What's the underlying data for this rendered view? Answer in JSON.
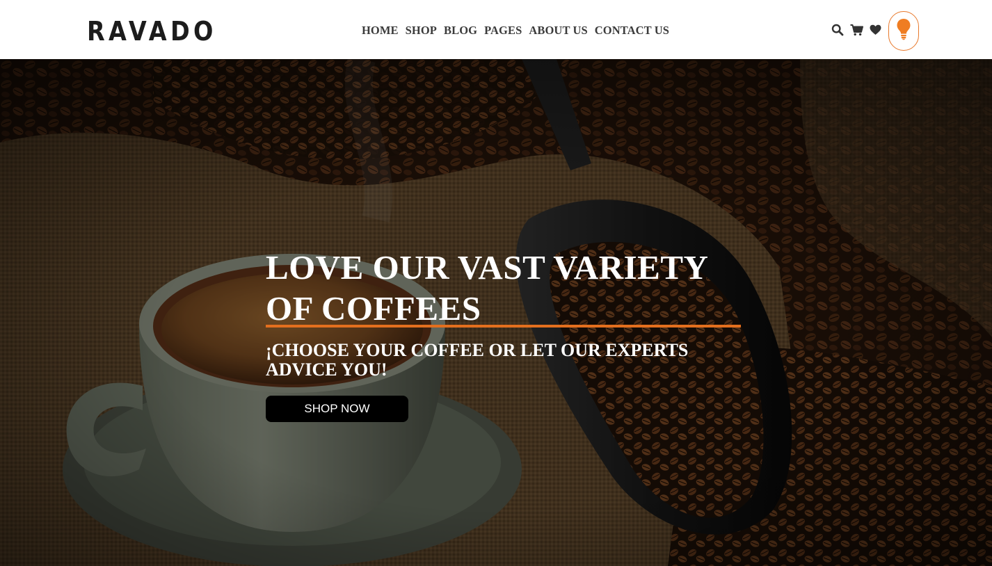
{
  "brand": {
    "logo_text": "RAVADO"
  },
  "nav": {
    "items": [
      {
        "label": "HOME"
      },
      {
        "label": "SHOP"
      },
      {
        "label": "BLOG"
      },
      {
        "label": "PAGES"
      },
      {
        "label": "ABOUT US"
      },
      {
        "label": "CONTACT US"
      }
    ]
  },
  "header_icons": [
    "search-icon",
    "cart-icon",
    "heart-icon",
    "lightbulb-icon"
  ],
  "hero": {
    "title": "LOVE OUR VAST VARIETY OF COFFEES",
    "subtitle": "¡CHOOSE YOUR COFFEE OR LET OUR EXPERTS ADVICE YOU!",
    "cta_label": "SHOP NOW"
  },
  "colors": {
    "accent": "#e36f1e",
    "header_bg": "#ffffff",
    "nav_text": "#3b3b3b",
    "cta_bg": "#000000",
    "hero_text": "#ffffff"
  }
}
